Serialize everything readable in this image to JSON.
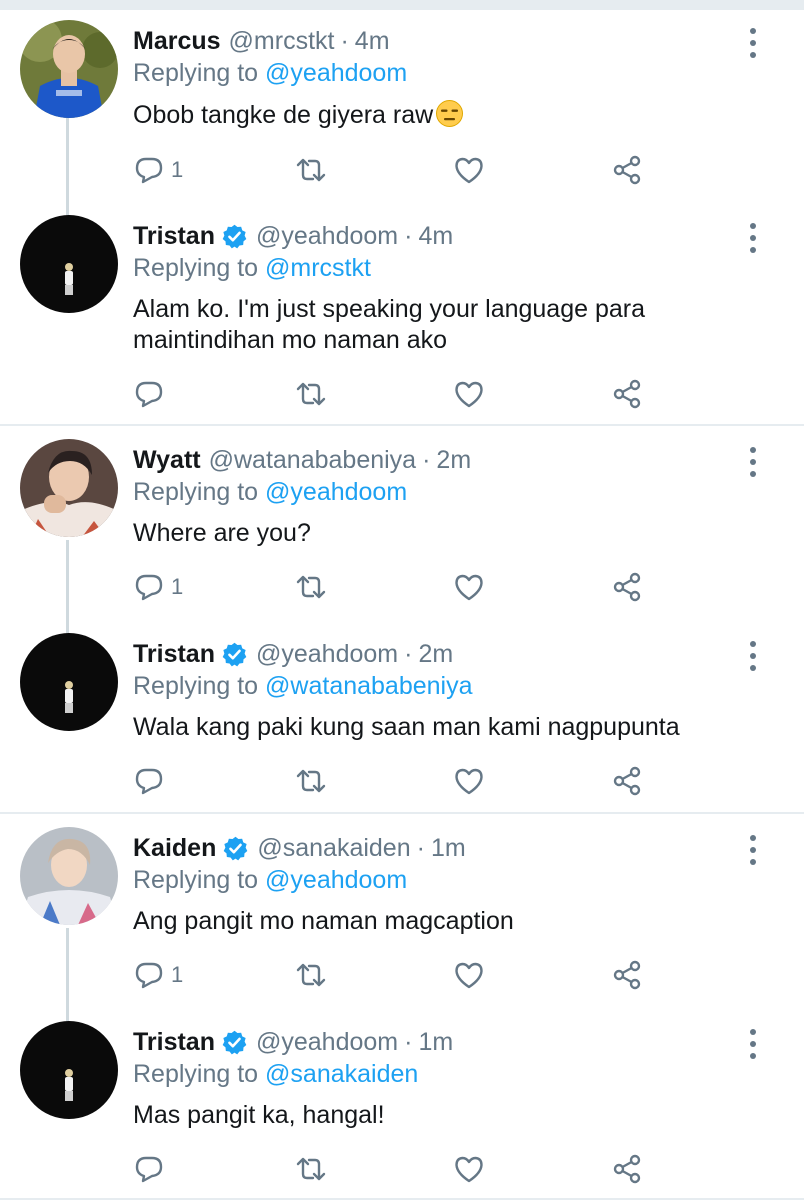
{
  "tweets": [
    {
      "name": "Marcus",
      "verified": false,
      "handle": "@mrcstkt",
      "time": "4m",
      "replying_label": "Replying to",
      "replying_handle": "@yeahdoom",
      "text": "Obob tangke de giyera raw",
      "emoji": "expressionless-face-emoji",
      "reply_count": "1",
      "avatar": "avatar-marcus"
    },
    {
      "name": "Tristan",
      "verified": true,
      "handle": "@yeahdoom",
      "time": "4m",
      "replying_label": "Replying to",
      "replying_handle": "@mrcstkt",
      "text": "Alam ko. I'm just speaking your language para maintindihan mo naman ako",
      "reply_count": "",
      "avatar": "avatar-tristan"
    },
    {
      "name": "Wyatt",
      "verified": false,
      "handle": "@watanababeniya",
      "time": "2m",
      "replying_label": "Replying to",
      "replying_handle": "@yeahdoom",
      "text": "Where are you?",
      "reply_count": "1",
      "avatar": "avatar-wyatt"
    },
    {
      "name": "Tristan",
      "verified": true,
      "handle": "@yeahdoom",
      "time": "2m",
      "replying_label": "Replying to",
      "replying_handle": "@watanababeniya",
      "text": "Wala kang paki kung saan man kami nagpupunta",
      "reply_count": "",
      "avatar": "avatar-tristan"
    },
    {
      "name": "Kaiden",
      "verified": true,
      "handle": "@sanakaiden",
      "time": "1m",
      "replying_label": "Replying to",
      "replying_handle": "@yeahdoom",
      "text": "Ang pangit mo naman magcaption",
      "reply_count": "1",
      "avatar": "avatar-kaiden"
    },
    {
      "name": "Tristan",
      "verified": true,
      "handle": "@yeahdoom",
      "time": "1m",
      "replying_label": "Replying to",
      "replying_handle": "@sanakaiden",
      "text": "Mas pangit ka, hangal!",
      "reply_count": "",
      "avatar": "avatar-tristan"
    }
  ],
  "separator": "·",
  "icons": {
    "reply": "reply-icon",
    "retweet": "retweet-icon",
    "like": "like-icon",
    "share": "share-icon",
    "more": "more-options-icon",
    "verified": "verified-badge-icon"
  },
  "colors": {
    "link": "#1da1f2",
    "secondary_text": "#657786",
    "primary_text": "#14171a",
    "divider": "#e6ecf0",
    "thread_line": "#cfd9de"
  }
}
